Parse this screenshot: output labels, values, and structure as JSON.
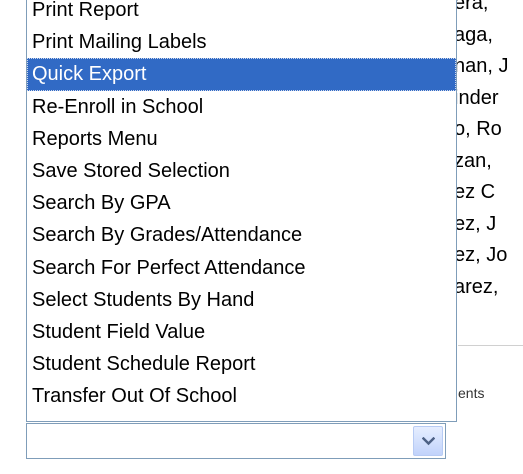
{
  "background": {
    "names": [
      "era,",
      "aga,",
      "nan, J",
      "inder",
      "o, Ro",
      "zan,",
      "ez C",
      "ez, J",
      "ez, Jo",
      "arez,"
    ],
    "students_label": "ents"
  },
  "dropdown": {
    "items": [
      {
        "label": "Print Report",
        "selected": false
      },
      {
        "label": "Print Mailing Labels",
        "selected": false
      },
      {
        "label": "Quick Export",
        "selected": true
      },
      {
        "label": "Re-Enroll in School",
        "selected": false
      },
      {
        "label": "Reports Menu",
        "selected": false
      },
      {
        "label": "Save Stored Selection",
        "selected": false
      },
      {
        "label": "Search By GPA",
        "selected": false
      },
      {
        "label": "Search By Grades/Attendance",
        "selected": false
      },
      {
        "label": "Search For Perfect Attendance",
        "selected": false
      },
      {
        "label": "Select Students By Hand",
        "selected": false
      },
      {
        "label": "Student Field Value",
        "selected": false
      },
      {
        "label": "Student Schedule Report",
        "selected": false
      },
      {
        "label": "Transfer Out Of School",
        "selected": false
      }
    ],
    "selected_value": "",
    "arrow_icon": "chevron-down-icon",
    "highlight_color": "#316ac5",
    "border_color": "#7f9db9"
  }
}
